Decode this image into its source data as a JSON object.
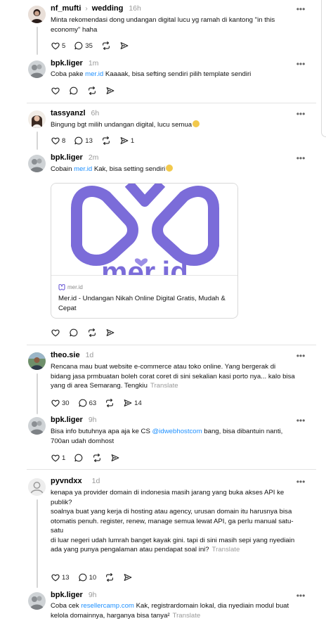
{
  "posts": [
    {
      "username": "nf_mufti",
      "reply_to": "wedding",
      "time": "16h",
      "text": "Minta rekomendasi dong undangan digital lucu yg ramah di kantong \"in this economy\" haha",
      "likes": "5",
      "replies": "35",
      "reposts": "",
      "shares": ""
    },
    {
      "username": "bpk.liger",
      "time": "1m",
      "text_before": "Coba pake ",
      "link": "mer.id",
      "text_after": " Kaaaak, bisa sefting sendiri pilih template sendiri"
    },
    {
      "username": "tassyanzl",
      "time": "6h",
      "text": "Bingung bgt milih undangan digital, lucu semua",
      "likes": "8",
      "replies": "13",
      "shares": "1"
    },
    {
      "username": "bpk.liger",
      "time": "2m",
      "text_before": "Cobain ",
      "link": "mer.id",
      "text_after": " Kak, bisa setting sendiri",
      "card": {
        "logo_text": "mer.id",
        "domain": "mer.id",
        "title": "Mer.id - Undangan Nikah Online Digital Gratis, Mudah & Cepat"
      }
    },
    {
      "username": "theo.sie",
      "time": "1d",
      "text": "Rencana mau buat website e-commerce atau toko online. Yang bergerak di bidang jasa prmbuatan boleh corat coret di sini sekalian kasi porto nya... kalo bisa yang di area Semarang. Tengkiu",
      "translate": "Translate",
      "likes": "30",
      "replies": "63",
      "shares": "14"
    },
    {
      "username": "bpk.liger",
      "time": "9h",
      "text_before": "Bisa info butuhnya apa aja ke CS ",
      "link": "@idwebhostcom",
      "text_after": " bang, bisa dibantuin nanti, 700an udah domhost",
      "likes": "1"
    },
    {
      "username": "pyvndxx",
      "time": "1d",
      "lines": [
        "kenapa ya provider domain di indonesia masih jarang yang buka akses API ke publik?",
        "soalnya buat yang kerja di hosting atau agency, urusan domain itu harusnya bisa otomatis penuh. register, renew, manage semua lewat API, ga perlu manual satu-satu",
        "di luar negeri udah lumrah banget kayak gini. tapi di sini masih sepi yang nyediain",
        "ada yang punya pengalaman atau pendapat soal ini?"
      ],
      "translate": "Translate",
      "likes": "13",
      "replies": "10"
    },
    {
      "username": "bpk.liger",
      "time": "9h",
      "text_before": "Coba cek ",
      "link": "resellercamp.com",
      "text_after": " Kak, registrardomain lokal, dia nyediain modul buat kelola domainnya, harganya bisa tanya²",
      "translate": "Translate"
    }
  ],
  "icons": {
    "like": "heart-icon",
    "reply": "comment-icon",
    "repost": "repost-icon",
    "share": "send-icon",
    "more": "more-options-icon"
  },
  "colors": {
    "link": "#1e90ff",
    "muted": "#999999",
    "brand_purple": "#7b6cd9"
  }
}
